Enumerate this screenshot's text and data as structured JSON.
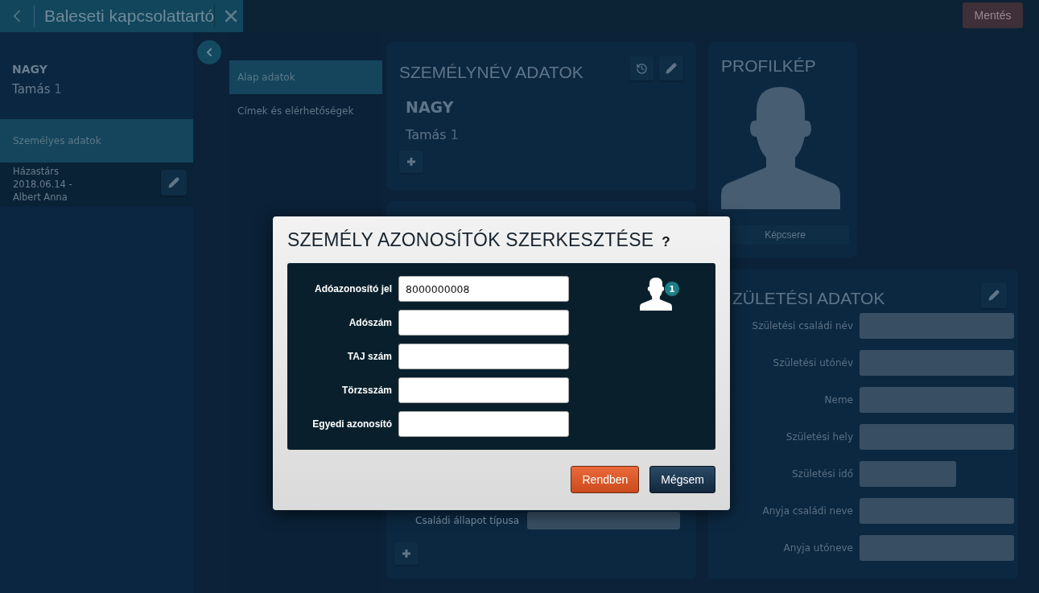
{
  "topbar": {
    "title": "Baleseti kapcsolattartó",
    "save_button": "Mentés"
  },
  "sidebar": {
    "family_name": "NAGY",
    "given_name": "Tamás",
    "given_index": "1",
    "items": [
      {
        "label": "Személyes adatok",
        "selected": true
      }
    ],
    "relation": {
      "lines": [
        "Házastárs",
        "2018.06.14 -",
        "Albert Anna"
      ]
    }
  },
  "nav": [
    {
      "label": "Alap adatok",
      "selected": true
    },
    {
      "label": "Címek és elérhetőségek",
      "selected": false
    }
  ],
  "name_card": {
    "title": "SZEMÉLYNÉV ADATOK",
    "family_name": "NAGY",
    "given_name": "Tamás",
    "given_index": "1"
  },
  "marital_card": {
    "field_label": "Családi állapot típusa"
  },
  "profile_card": {
    "title": "PROFILKÉP",
    "button": "Képcsere"
  },
  "birth_card": {
    "title": "ZÜLETÉSI ADATOK",
    "fields": [
      {
        "label": "Születési családi név",
        "kind": "text"
      },
      {
        "label": "Születési utónév",
        "kind": "text"
      },
      {
        "label": "Neme",
        "kind": "text"
      },
      {
        "label": "Születési hely",
        "kind": "text"
      },
      {
        "label": "Születési idő",
        "kind": "date"
      },
      {
        "label": "Anyja családi neve",
        "kind": "text"
      },
      {
        "label": "Anyja utóneve",
        "kind": "text"
      }
    ]
  },
  "modal": {
    "title": "SZEMÉLY AZONOSÍTÓK SZERKESZTÉSE",
    "help": "?",
    "badge": "1",
    "fields": [
      {
        "label": "Adóazonosító jel",
        "value": "8000000008"
      },
      {
        "label": "Adószám"
      },
      {
        "label": "TAJ szám"
      },
      {
        "label": "Törzsszám"
      },
      {
        "label": "Egyedi azonosító"
      }
    ],
    "buttons": [
      {
        "label": "Rendben",
        "kind": "primary"
      },
      {
        "label": "Mégsem",
        "kind": "secondary"
      }
    ]
  }
}
